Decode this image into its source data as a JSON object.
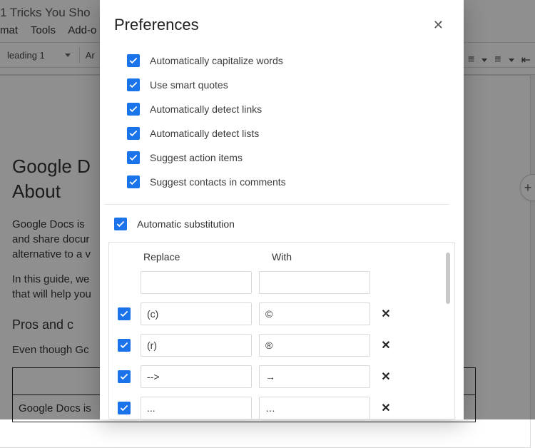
{
  "background": {
    "doc_title_fragment": "1 Tricks You Sho",
    "menu": {
      "format_fragment": "mat",
      "tools": "Tools",
      "addons_fragment": "Add-o"
    },
    "toolbar": {
      "style_label": "leading 1",
      "font_fragment": "Ar"
    },
    "heading1_line1": "Google D",
    "heading1_line2": "About",
    "para1_line1": "Google Docs is",
    "para1_line2": "and share docur",
    "para1_line3": "alternative to a v",
    "para2_line1": "In this guide, we",
    "para2_line2": "that will help you",
    "heading2": "Pros and c",
    "para3": "Even though Gc",
    "table_cell": "Google Docs is"
  },
  "dialog": {
    "title": "Preferences",
    "prefs": [
      {
        "id": "capitalize",
        "label": "Automatically capitalize words",
        "checked": true
      },
      {
        "id": "smart-quotes",
        "label": "Use smart quotes",
        "checked": true
      },
      {
        "id": "detect-links",
        "label": "Automatically detect links",
        "checked": true
      },
      {
        "id": "detect-lists",
        "label": "Automatically detect lists",
        "checked": true
      },
      {
        "id": "action-items",
        "label": "Suggest action items",
        "checked": true
      },
      {
        "id": "contacts",
        "label": "Suggest contacts in comments",
        "checked": true
      }
    ],
    "auto_substitution": {
      "label": "Automatic substitution",
      "checked": true
    },
    "subs": {
      "headers": {
        "replace": "Replace",
        "with": "With"
      },
      "rows": [
        {
          "enabled": null,
          "replace": "",
          "with": "",
          "removable": false
        },
        {
          "enabled": true,
          "replace": "(c)",
          "with": "©",
          "removable": true
        },
        {
          "enabled": true,
          "replace": "(r)",
          "with": "®",
          "removable": true
        },
        {
          "enabled": true,
          "replace": "-->",
          "with": "→",
          "removable": true
        },
        {
          "enabled": true,
          "replace": "...",
          "with": "…",
          "removable": true
        }
      ]
    }
  },
  "glyphs": {
    "close_x": "✕",
    "remove_x": "✕",
    "bullet_list": "≡",
    "indent_decrease": "⇤",
    "plus": "+"
  }
}
